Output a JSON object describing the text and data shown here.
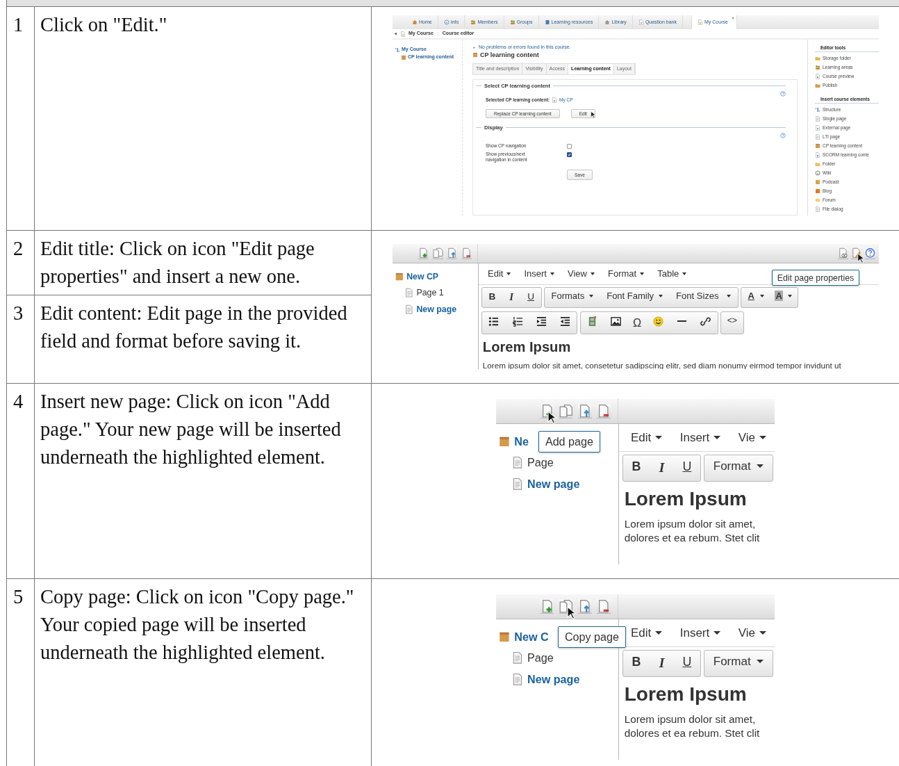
{
  "rows": [
    {
      "steps": [
        {
          "number": "1",
          "text": "Click on \"Edit.\""
        }
      ],
      "screenshot": {
        "kind": "course-editor",
        "tabs": [
          {
            "label": "Home",
            "selected": false
          },
          {
            "label": "Info",
            "selected": false
          },
          {
            "label": "Members",
            "selected": false
          },
          {
            "label": "Groups",
            "selected": false
          },
          {
            "label": "Learning resources",
            "selected": false
          },
          {
            "label": "Library",
            "selected": false
          },
          {
            "label": "Question bank",
            "selected": false
          },
          {
            "label": "My Course",
            "selected": true,
            "close": "×"
          }
        ],
        "breadcrumb": [
          "My Course",
          "Course editor"
        ],
        "tree": {
          "label": "My Course",
          "children": [
            {
              "label": "CP learning content"
            }
          ]
        },
        "status": "No problems or errors found in this course.",
        "title": "CP learning content",
        "subtabs": [
          {
            "label": "Title and description",
            "selected": false
          },
          {
            "label": "Visibility",
            "selected": false
          },
          {
            "label": "Access",
            "selected": false
          },
          {
            "label": "Learning content",
            "selected": true
          },
          {
            "label": "Layout",
            "selected": false
          }
        ],
        "select_section": {
          "legend": "Select CP learning content",
          "label": "Selected CP learning content:",
          "value": "My CP",
          "buttons": [
            {
              "label": "Replace CP learning content",
              "hovered": false
            },
            {
              "label": "Edit",
              "hovered": true
            }
          ]
        },
        "display_section": {
          "legend": "Display",
          "options": [
            {
              "label": "Show CP navigation",
              "checked": false
            },
            {
              "label": "Show previous/next navigation in content",
              "checked": true
            }
          ],
          "button": "Save"
        },
        "sidebar": [
          {
            "title": "Editor tools",
            "items": [
              "Storage folder",
              "Learning areas",
              "Course preview",
              "Publish"
            ]
          },
          {
            "title": "Insert course elements",
            "items": [
              "Structure",
              "Single page",
              "External page",
              "LTI page",
              "CP learning content",
              "SCORM learning conte",
              "Folder",
              "Wiki",
              "Podcast",
              "Blog",
              "Forum",
              "File dialog"
            ]
          }
        ]
      }
    },
    {
      "steps": [
        {
          "number": "2",
          "text": "Edit title: Click on icon \"Edit page properties\" and insert a new one."
        },
        {
          "number": "3",
          "text": "Edit content: Edit page in the provided field and format before saving it."
        }
      ],
      "screenshot": {
        "kind": "cp-editor",
        "page_tools": [
          {
            "hovered": false
          },
          {
            "hovered": false
          },
          {
            "hovered": false
          },
          {
            "hovered": false
          }
        ],
        "view_tools": [
          {
            "hovered": false
          },
          {
            "hovered": true
          },
          {
            "hovered": false
          }
        ],
        "tree": {
          "label": "New CP",
          "children": [
            {
              "label": "Page 1",
              "selected": false
            },
            {
              "label": "New page",
              "selected": true
            }
          ]
        },
        "menu": [
          "Edit",
          "Insert",
          "View",
          "Format",
          "Table"
        ],
        "format_buttons": [
          "B",
          "I",
          "U"
        ],
        "dropdowns": [
          "Formats",
          "Font Family",
          "Font Sizes"
        ],
        "color_buttons": [
          "A",
          "A"
        ],
        "symbol_button": "Ω",
        "code_button": "<>",
        "heading": "Lorem Ipsum",
        "lines": [
          "Lorem ipsum dolor sit amet, consetetur sadipscing elitr, sed diam nonumy eirmod tempor invidunt ut"
        ],
        "tooltip": "Edit page properties"
      }
    },
    {
      "steps": [
        {
          "number": "4",
          "text": "Insert new page: Click on icon \"Add page.\" Your new page will be inserted underneath the highlighted element."
        }
      ],
      "screenshot": {
        "kind": "cp-editor-zoom",
        "page_tools": [
          {
            "hovered": true
          },
          {
            "hovered": false
          },
          {
            "hovered": false
          },
          {
            "hovered": false
          }
        ],
        "tree": {
          "label": "Ne",
          "children": [
            {
              "label": "Page",
              "selected": false
            },
            {
              "label": "New page",
              "selected": true
            }
          ]
        },
        "menu": [
          "Edit",
          "Insert",
          "Vie"
        ],
        "format_buttons": [
          "B",
          "I",
          "U"
        ],
        "dropdowns": [
          "Format"
        ],
        "heading": "Lorem Ipsum",
        "lines": [
          "Lorem ipsum dolor sit amet,",
          "dolores et ea rebum. Stet clit"
        ],
        "tooltip": "Add page"
      }
    },
    {
      "steps": [
        {
          "number": "5",
          "text": "Copy page: Click on icon \"Copy page.\" Your copied page will be inserted underneath the highlighted element."
        }
      ],
      "screenshot": {
        "kind": "cp-editor-zoom",
        "page_tools": [
          {
            "hovered": false
          },
          {
            "hovered": true
          },
          {
            "hovered": false
          },
          {
            "hovered": false
          }
        ],
        "tree": {
          "label": "New C",
          "children": [
            {
              "label": "Page",
              "selected": false
            },
            {
              "label": "New page",
              "selected": true
            }
          ]
        },
        "menu": [
          "Edit",
          "Insert",
          "Vie"
        ],
        "format_buttons": [
          "B",
          "I",
          "U"
        ],
        "dropdowns": [
          "Format"
        ],
        "heading": "Lorem Ipsum",
        "lines": [
          "Lorem ipsum dolor sit amet,",
          "dolores et ea rebum. Stet clit"
        ],
        "tooltip": "Copy page"
      }
    }
  ]
}
